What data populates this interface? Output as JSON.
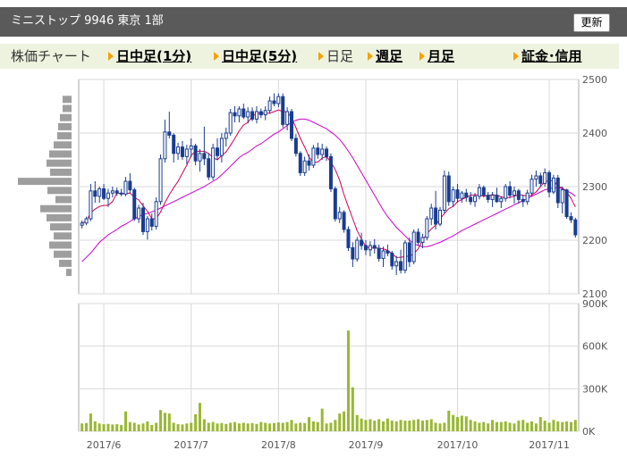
{
  "header": {
    "title": "ミニストップ 9946 東京 1部",
    "refresh_label": "更新"
  },
  "nav": {
    "items": [
      {
        "label": "株価チャート",
        "link": false
      },
      {
        "label": "日中足(1分)",
        "link": true
      },
      {
        "label": "日中足(5分)",
        "link": true
      },
      {
        "label": "日足",
        "link": false
      },
      {
        "label": "週足",
        "link": true
      },
      {
        "label": "月足",
        "link": true
      },
      {
        "label": "証金･信用",
        "link": true
      }
    ]
  },
  "chart_data": {
    "type": "candlestick",
    "price_axis": {
      "min": 2100,
      "max": 2500,
      "ticks": [
        "2500",
        "2400",
        "2300",
        "2200",
        "2100"
      ]
    },
    "volume_axis": {
      "min": 0,
      "max": 900000,
      "ticks": [
        "900K",
        "600K",
        "300K",
        "0K"
      ]
    },
    "x_labels": [
      "2017/6",
      "2017/7",
      "2017/8",
      "2017/9",
      "2017/10",
      "2017/11"
    ],
    "x_label_index": [
      5,
      25,
      45,
      65,
      86,
      107
    ],
    "grid": true,
    "colors": {
      "up": "#ffffff",
      "down": "#1a3d8f",
      "ma_short": "#d4005a",
      "ma_long": "#cc00cc",
      "volume": "#99b833",
      "volume_profile": "#9e9e9e"
    },
    "candles": [
      {
        "o": 2228,
        "h": 2237,
        "l": 2222,
        "c": 2232
      },
      {
        "o": 2232,
        "h": 2244,
        "l": 2228,
        "c": 2240
      },
      {
        "o": 2240,
        "h": 2305,
        "l": 2236,
        "c": 2292
      },
      {
        "o": 2292,
        "h": 2310,
        "l": 2270,
        "c": 2282
      },
      {
        "o": 2282,
        "h": 2300,
        "l": 2270,
        "c": 2296
      },
      {
        "o": 2296,
        "h": 2305,
        "l": 2275,
        "c": 2278
      },
      {
        "o": 2278,
        "h": 2296,
        "l": 2262,
        "c": 2288
      },
      {
        "o": 2288,
        "h": 2300,
        "l": 2280,
        "c": 2292
      },
      {
        "o": 2292,
        "h": 2298,
        "l": 2283,
        "c": 2288
      },
      {
        "o": 2288,
        "h": 2296,
        "l": 2282,
        "c": 2286
      },
      {
        "o": 2286,
        "h": 2318,
        "l": 2282,
        "c": 2310
      },
      {
        "o": 2310,
        "h": 2325,
        "l": 2288,
        "c": 2294
      },
      {
        "o": 2294,
        "h": 2298,
        "l": 2236,
        "c": 2240
      },
      {
        "o": 2240,
        "h": 2266,
        "l": 2232,
        "c": 2260
      },
      {
        "o": 2260,
        "h": 2270,
        "l": 2210,
        "c": 2216
      },
      {
        "o": 2216,
        "h": 2245,
        "l": 2201,
        "c": 2240
      },
      {
        "o": 2240,
        "h": 2250,
        "l": 2218,
        "c": 2226
      },
      {
        "o": 2226,
        "h": 2280,
        "l": 2220,
        "c": 2272
      },
      {
        "o": 2272,
        "h": 2360,
        "l": 2266,
        "c": 2352
      },
      {
        "o": 2352,
        "h": 2425,
        "l": 2345,
        "c": 2402
      },
      {
        "o": 2402,
        "h": 2440,
        "l": 2390,
        "c": 2396
      },
      {
        "o": 2396,
        "h": 2400,
        "l": 2345,
        "c": 2362
      },
      {
        "o": 2362,
        "h": 2382,
        "l": 2350,
        "c": 2374
      },
      {
        "o": 2374,
        "h": 2385,
        "l": 2350,
        "c": 2356
      },
      {
        "o": 2356,
        "h": 2378,
        "l": 2342,
        "c": 2370
      },
      {
        "o": 2370,
        "h": 2390,
        "l": 2355,
        "c": 2376
      },
      {
        "o": 2376,
        "h": 2380,
        "l": 2340,
        "c": 2348
      },
      {
        "o": 2348,
        "h": 2370,
        "l": 2328,
        "c": 2362
      },
      {
        "o": 2362,
        "h": 2412,
        "l": 2340,
        "c": 2352
      },
      {
        "o": 2352,
        "h": 2362,
        "l": 2312,
        "c": 2318
      },
      {
        "o": 2318,
        "h": 2380,
        "l": 2312,
        "c": 2372
      },
      {
        "o": 2372,
        "h": 2390,
        "l": 2350,
        "c": 2358
      },
      {
        "o": 2358,
        "h": 2400,
        "l": 2345,
        "c": 2390
      },
      {
        "o": 2390,
        "h": 2410,
        "l": 2375,
        "c": 2400
      },
      {
        "o": 2400,
        "h": 2445,
        "l": 2395,
        "c": 2438
      },
      {
        "o": 2438,
        "h": 2450,
        "l": 2420,
        "c": 2432
      },
      {
        "o": 2432,
        "h": 2450,
        "l": 2420,
        "c": 2445
      },
      {
        "o": 2445,
        "h": 2455,
        "l": 2426,
        "c": 2430
      },
      {
        "o": 2430,
        "h": 2448,
        "l": 2418,
        "c": 2440
      },
      {
        "o": 2440,
        "h": 2448,
        "l": 2422,
        "c": 2426
      },
      {
        "o": 2426,
        "h": 2450,
        "l": 2418,
        "c": 2440
      },
      {
        "o": 2440,
        "h": 2446,
        "l": 2428,
        "c": 2434
      },
      {
        "o": 2434,
        "h": 2450,
        "l": 2424,
        "c": 2442
      },
      {
        "o": 2442,
        "h": 2468,
        "l": 2436,
        "c": 2460
      },
      {
        "o": 2460,
        "h": 2474,
        "l": 2450,
        "c": 2455
      },
      {
        "o": 2455,
        "h": 2474,
        "l": 2448,
        "c": 2468
      },
      {
        "o": 2468,
        "h": 2474,
        "l": 2410,
        "c": 2416
      },
      {
        "o": 2416,
        "h": 2448,
        "l": 2405,
        "c": 2440
      },
      {
        "o": 2440,
        "h": 2445,
        "l": 2385,
        "c": 2390
      },
      {
        "o": 2390,
        "h": 2398,
        "l": 2356,
        "c": 2362
      },
      {
        "o": 2362,
        "h": 2366,
        "l": 2320,
        "c": 2326
      },
      {
        "o": 2326,
        "h": 2356,
        "l": 2320,
        "c": 2348
      },
      {
        "o": 2348,
        "h": 2360,
        "l": 2330,
        "c": 2340
      },
      {
        "o": 2340,
        "h": 2378,
        "l": 2335,
        "c": 2372
      },
      {
        "o": 2372,
        "h": 2382,
        "l": 2352,
        "c": 2360
      },
      {
        "o": 2360,
        "h": 2380,
        "l": 2350,
        "c": 2370
      },
      {
        "o": 2370,
        "h": 2375,
        "l": 2348,
        "c": 2356
      },
      {
        "o": 2356,
        "h": 2362,
        "l": 2290,
        "c": 2296
      },
      {
        "o": 2296,
        "h": 2300,
        "l": 2235,
        "c": 2240
      },
      {
        "o": 2240,
        "h": 2262,
        "l": 2232,
        "c": 2252
      },
      {
        "o": 2252,
        "h": 2256,
        "l": 2214,
        "c": 2220
      },
      {
        "o": 2220,
        "h": 2226,
        "l": 2180,
        "c": 2186
      },
      {
        "o": 2186,
        "h": 2196,
        "l": 2150,
        "c": 2165
      },
      {
        "o": 2165,
        "h": 2206,
        "l": 2160,
        "c": 2200
      },
      {
        "o": 2200,
        "h": 2214,
        "l": 2182,
        "c": 2190
      },
      {
        "o": 2190,
        "h": 2200,
        "l": 2172,
        "c": 2182
      },
      {
        "o": 2182,
        "h": 2198,
        "l": 2170,
        "c": 2190
      },
      {
        "o": 2190,
        "h": 2202,
        "l": 2175,
        "c": 2185
      },
      {
        "o": 2185,
        "h": 2192,
        "l": 2160,
        "c": 2166
      },
      {
        "o": 2166,
        "h": 2188,
        "l": 2150,
        "c": 2180
      },
      {
        "o": 2180,
        "h": 2192,
        "l": 2170,
        "c": 2176
      },
      {
        "o": 2176,
        "h": 2180,
        "l": 2145,
        "c": 2152
      },
      {
        "o": 2152,
        "h": 2170,
        "l": 2135,
        "c": 2160
      },
      {
        "o": 2160,
        "h": 2182,
        "l": 2138,
        "c": 2144
      },
      {
        "o": 2144,
        "h": 2200,
        "l": 2138,
        "c": 2195
      },
      {
        "o": 2195,
        "h": 2205,
        "l": 2150,
        "c": 2160
      },
      {
        "o": 2160,
        "h": 2220,
        "l": 2155,
        "c": 2215
      },
      {
        "o": 2215,
        "h": 2222,
        "l": 2190,
        "c": 2196
      },
      {
        "o": 2196,
        "h": 2212,
        "l": 2185,
        "c": 2205
      },
      {
        "o": 2205,
        "h": 2245,
        "l": 2200,
        "c": 2240
      },
      {
        "o": 2240,
        "h": 2268,
        "l": 2228,
        "c": 2260
      },
      {
        "o": 2260,
        "h": 2292,
        "l": 2220,
        "c": 2230
      },
      {
        "o": 2230,
        "h": 2262,
        "l": 2226,
        "c": 2256
      },
      {
        "o": 2256,
        "h": 2330,
        "l": 2250,
        "c": 2320
      },
      {
        "o": 2320,
        "h": 2328,
        "l": 2264,
        "c": 2272
      },
      {
        "o": 2272,
        "h": 2300,
        "l": 2262,
        "c": 2294
      },
      {
        "o": 2294,
        "h": 2305,
        "l": 2270,
        "c": 2278
      },
      {
        "o": 2278,
        "h": 2292,
        "l": 2270,
        "c": 2288
      },
      {
        "o": 2288,
        "h": 2296,
        "l": 2272,
        "c": 2280
      },
      {
        "o": 2280,
        "h": 2290,
        "l": 2266,
        "c": 2272
      },
      {
        "o": 2272,
        "h": 2288,
        "l": 2262,
        "c": 2282
      },
      {
        "o": 2282,
        "h": 2305,
        "l": 2276,
        "c": 2298
      },
      {
        "o": 2298,
        "h": 2302,
        "l": 2280,
        "c": 2284
      },
      {
        "o": 2284,
        "h": 2290,
        "l": 2270,
        "c": 2276
      },
      {
        "o": 2276,
        "h": 2290,
        "l": 2262,
        "c": 2284
      },
      {
        "o": 2284,
        "h": 2298,
        "l": 2270,
        "c": 2272
      },
      {
        "o": 2272,
        "h": 2282,
        "l": 2260,
        "c": 2278
      },
      {
        "o": 2278,
        "h": 2305,
        "l": 2272,
        "c": 2300
      },
      {
        "o": 2300,
        "h": 2310,
        "l": 2278,
        "c": 2284
      },
      {
        "o": 2284,
        "h": 2300,
        "l": 2268,
        "c": 2292
      },
      {
        "o": 2292,
        "h": 2296,
        "l": 2268,
        "c": 2276
      },
      {
        "o": 2276,
        "h": 2285,
        "l": 2262,
        "c": 2272
      },
      {
        "o": 2272,
        "h": 2294,
        "l": 2266,
        "c": 2288
      },
      {
        "o": 2288,
        "h": 2322,
        "l": 2282,
        "c": 2314
      },
      {
        "o": 2314,
        "h": 2330,
        "l": 2300,
        "c": 2320
      },
      {
        "o": 2320,
        "h": 2326,
        "l": 2300,
        "c": 2306
      },
      {
        "o": 2306,
        "h": 2334,
        "l": 2300,
        "c": 2326
      },
      {
        "o": 2326,
        "h": 2330,
        "l": 2280,
        "c": 2290
      },
      {
        "o": 2290,
        "h": 2322,
        "l": 2286,
        "c": 2316
      },
      {
        "o": 2316,
        "h": 2322,
        "l": 2260,
        "c": 2270
      },
      {
        "o": 2270,
        "h": 2300,
        "l": 2250,
        "c": 2294
      },
      {
        "o": 2294,
        "h": 2296,
        "l": 2240,
        "c": 2244
      },
      {
        "o": 2244,
        "h": 2252,
        "l": 2232,
        "c": 2238
      },
      {
        "o": 2238,
        "h": 2242,
        "l": 2205,
        "c": 2210
      }
    ],
    "ma_short": [
      2232,
      2236,
      2251,
      2258,
      2263,
      2265,
      2265,
      2272,
      2288,
      2287,
      2287,
      2288,
      2280,
      2275,
      2264,
      2254,
      2240,
      2240,
      2253,
      2270,
      2285,
      2298,
      2310,
      2325,
      2340,
      2358,
      2366,
      2366,
      2366,
      2362,
      2354,
      2350,
      2358,
      2365,
      2377,
      2390,
      2404,
      2415,
      2420,
      2431,
      2437,
      2437,
      2437,
      2437,
      2440,
      2443,
      2440,
      2440,
      2428,
      2410,
      2390,
      2374,
      2355,
      2345,
      2346,
      2353,
      2356,
      2346,
      2332,
      2312,
      2285,
      2262,
      2240,
      2218,
      2202,
      2188,
      2185,
      2186,
      2185,
      2184,
      2181,
      2175,
      2168,
      2168,
      2170,
      2170,
      2175,
      2184,
      2200,
      2212,
      2221,
      2228,
      2240,
      2250,
      2259,
      2263,
      2272,
      2276,
      2280,
      2284,
      2285,
      2284,
      2282,
      2283,
      2285,
      2284,
      2281,
      2279,
      2280,
      2282,
      2285,
      2284,
      2282,
      2284,
      2290,
      2300,
      2310,
      2310,
      2312,
      2300,
      2298,
      2290,
      2278,
      2262
    ],
    "ma_long": [
      2160,
      2168,
      2176,
      2186,
      2196,
      2203,
      2210,
      2215,
      2220,
      2226,
      2230,
      2235,
      2240,
      2244,
      2248,
      2250,
      2253,
      2256,
      2260,
      2264,
      2268,
      2272,
      2276,
      2280,
      2284,
      2288,
      2292,
      2296,
      2300,
      2305,
      2310,
      2315,
      2322,
      2330,
      2338,
      2346,
      2354,
      2360,
      2364,
      2370,
      2376,
      2380,
      2386,
      2392,
      2398,
      2402,
      2408,
      2414,
      2420,
      2424,
      2426,
      2426,
      2424,
      2420,
      2416,
      2412,
      2408,
      2402,
      2396,
      2388,
      2378,
      2366,
      2354,
      2340,
      2326,
      2312,
      2298,
      2284,
      2270,
      2256,
      2244,
      2234,
      2224,
      2216,
      2208,
      2200,
      2194,
      2190,
      2188,
      2188,
      2190,
      2193,
      2196,
      2200,
      2204,
      2208,
      2213,
      2218,
      2222,
      2226,
      2230,
      2234,
      2238,
      2242,
      2246,
      2250,
      2254,
      2258,
      2262,
      2266,
      2270,
      2274,
      2278,
      2282,
      2286,
      2290,
      2294,
      2296,
      2298,
      2298,
      2296,
      2292,
      2288,
      2282
    ],
    "volume": [
      55000,
      58000,
      125000,
      70000,
      55000,
      50000,
      52000,
      48000,
      50000,
      45000,
      140000,
      65000,
      60000,
      48000,
      55000,
      70000,
      45000,
      60000,
      150000,
      130000,
      125000,
      60000,
      50000,
      48000,
      55000,
      60000,
      120000,
      200000,
      85000,
      60000,
      65000,
      55000,
      58000,
      52000,
      60000,
      65000,
      55000,
      60000,
      55000,
      58000,
      52000,
      65000,
      60000,
      55000,
      58000,
      62000,
      60000,
      65000,
      80000,
      55000,
      60000,
      58000,
      100000,
      70000,
      65000,
      160000,
      55000,
      60000,
      80000,
      125000,
      140000,
      710000,
      310000,
      115000,
      90000,
      80000,
      85000,
      75000,
      85000,
      70000,
      90000,
      75000,
      70000,
      80000,
      75000,
      75000,
      80000,
      85000,
      75000,
      80000,
      85000,
      60000,
      55000,
      60000,
      145000,
      115000,
      100000,
      110000,
      105000,
      80000,
      70000,
      60000,
      65000,
      55000,
      80000,
      65000,
      65000,
      70000,
      60000,
      55000,
      75000,
      80000,
      60000,
      70000,
      55000,
      100000,
      75000,
      60000,
      80000,
      70000,
      65000,
      70000,
      65000,
      80000
    ],
    "volume_profile": [
      {
        "price": 2462,
        "len": 10
      },
      {
        "price": 2445,
        "len": 10
      },
      {
        "price": 2428,
        "len": 13
      },
      {
        "price": 2411,
        "len": 15
      },
      {
        "price": 2394,
        "len": 16
      },
      {
        "price": 2377,
        "len": 20
      },
      {
        "price": 2360,
        "len": 25
      },
      {
        "price": 2343,
        "len": 28
      },
      {
        "price": 2326,
        "len": 24
      },
      {
        "price": 2309,
        "len": 60
      },
      {
        "price": 2292,
        "len": 27
      },
      {
        "price": 2275,
        "len": 18
      },
      {
        "price": 2258,
        "len": 35
      },
      {
        "price": 2241,
        "len": 28
      },
      {
        "price": 2224,
        "len": 24
      },
      {
        "price": 2207,
        "len": 20
      },
      {
        "price": 2190,
        "len": 25
      },
      {
        "price": 2173,
        "len": 20
      },
      {
        "price": 2156,
        "len": 14
      },
      {
        "price": 2139,
        "len": 6
      }
    ]
  }
}
